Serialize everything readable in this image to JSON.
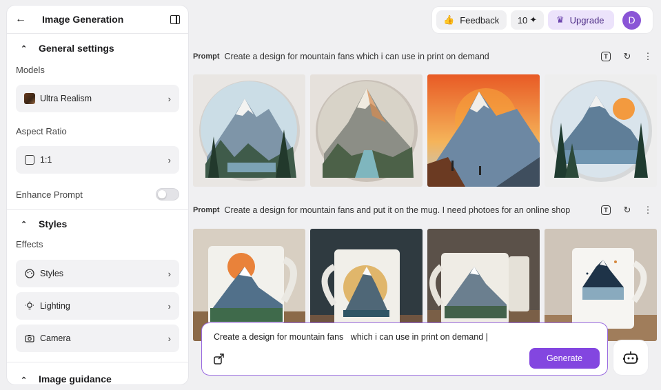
{
  "sidebar": {
    "title": "Image Generation",
    "general_settings": "General settings",
    "models_label": "Models",
    "model_value": "Ultra Realism",
    "aspect_label": "Aspect Ratio",
    "aspect_value": "1:1",
    "enhance_label": "Enhance Prompt",
    "enhance_on": false,
    "styles_section": "Styles",
    "effects_label": "Effects",
    "effects": [
      {
        "label": "Styles",
        "icon": "palette-icon"
      },
      {
        "label": "Lighting",
        "icon": "bulb-icon"
      },
      {
        "label": "Camera",
        "icon": "camera-icon"
      }
    ],
    "image_guidance": "Image guidance"
  },
  "topbar": {
    "feedback": "Feedback",
    "credits": "10",
    "upgrade": "Upgrade",
    "avatar_letter": "D"
  },
  "prompts": [
    {
      "tag": "Prompt",
      "text": "Create a design for mountain fans which i can use in print on demand"
    },
    {
      "tag": "Prompt",
      "text": "Create a design for mountain fans and put it on the mug. I need photoes for an online shop"
    }
  ],
  "composer": {
    "text": "Create a design for mountain fans   which i can use in print on demand |",
    "generate": "Generate"
  },
  "colors": {
    "accent": "#8346e0",
    "upgrade_bg": "#ece3fb",
    "avatar": "#8a55d6"
  }
}
